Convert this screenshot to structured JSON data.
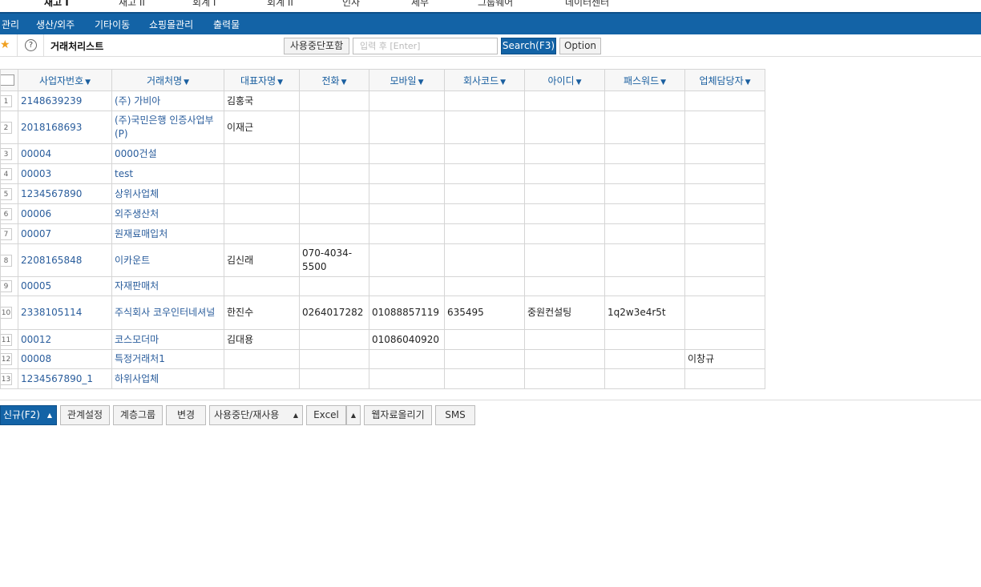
{
  "top_nav": [
    "재고 I",
    "재고 II",
    "회계 I",
    "회계 II",
    "인사",
    "세무",
    "그룹웨어",
    "데이터센터"
  ],
  "menu": [
    "관리",
    "생산/외주",
    "기타이동",
    "쇼핑몰관리",
    "출력물"
  ],
  "toolbar": {
    "title": "거래처리스트",
    "include_inactive": "사용중단포함",
    "search_placeholder": "입력 후 [Enter]",
    "search_button": "Search(F3)",
    "option_button": "Option"
  },
  "table": {
    "columns": [
      "사업자번호",
      "거래처명",
      "대표자명",
      "전화",
      "모바일",
      "회사코드",
      "아이디",
      "패스워드",
      "업체담당자"
    ],
    "rows": [
      [
        "1",
        "2148639239",
        "(주) 가비아",
        "김홍국",
        "",
        "",
        "",
        "",
        "",
        ""
      ],
      [
        "2",
        "2018168693",
        "(주)국민은행 인증사업부(P)",
        "이재근",
        "",
        "",
        "",
        "",
        "",
        ""
      ],
      [
        "3",
        "00004",
        "0000건설",
        "",
        "",
        "",
        "",
        "",
        "",
        ""
      ],
      [
        "4",
        "00003",
        "test",
        "",
        "",
        "",
        "",
        "",
        "",
        ""
      ],
      [
        "5",
        "1234567890",
        "상위사업체",
        "",
        "",
        "",
        "",
        "",
        "",
        ""
      ],
      [
        "6",
        "00006",
        "외주생산처",
        "",
        "",
        "",
        "",
        "",
        "",
        ""
      ],
      [
        "7",
        "00007",
        "원재료매입처",
        "",
        "",
        "",
        "",
        "",
        "",
        ""
      ],
      [
        "8",
        "2208165848",
        "이카운트",
        "김신래",
        "070-4034-5500",
        "",
        "",
        "",
        "",
        ""
      ],
      [
        "9",
        "00005",
        "자재판매처",
        "",
        "",
        "",
        "",
        "",
        "",
        ""
      ],
      [
        "10",
        "2338105114",
        "주식회사 코우인터네셔널",
        "한진수",
        "0264017282",
        "01088857119",
        "635495",
        "중원컨설팅",
        "1q2w3e4r5t",
        ""
      ],
      [
        "11",
        "00012",
        "코스모더마",
        "김대용",
        "",
        "01086040920",
        "",
        "",
        "",
        ""
      ],
      [
        "12",
        "00008",
        "특정거래처1",
        "",
        "",
        "",
        "",
        "",
        "",
        "이창규"
      ],
      [
        "13",
        "1234567890_1",
        "하위사업체",
        "",
        "",
        "",
        "",
        "",
        "",
        ""
      ]
    ]
  },
  "bottom_buttons": {
    "new": "신규(F2)",
    "relation": "관계설정",
    "hierarchy": "계층그룹",
    "change": "변경",
    "suspend": "사용중단/재사용",
    "excel": "Excel",
    "upload": "웹자료올리기",
    "sms": "SMS"
  },
  "colors": {
    "primary": "#1363a6",
    "header_text": "#1a5fa0",
    "link": "#2a5d9c"
  }
}
